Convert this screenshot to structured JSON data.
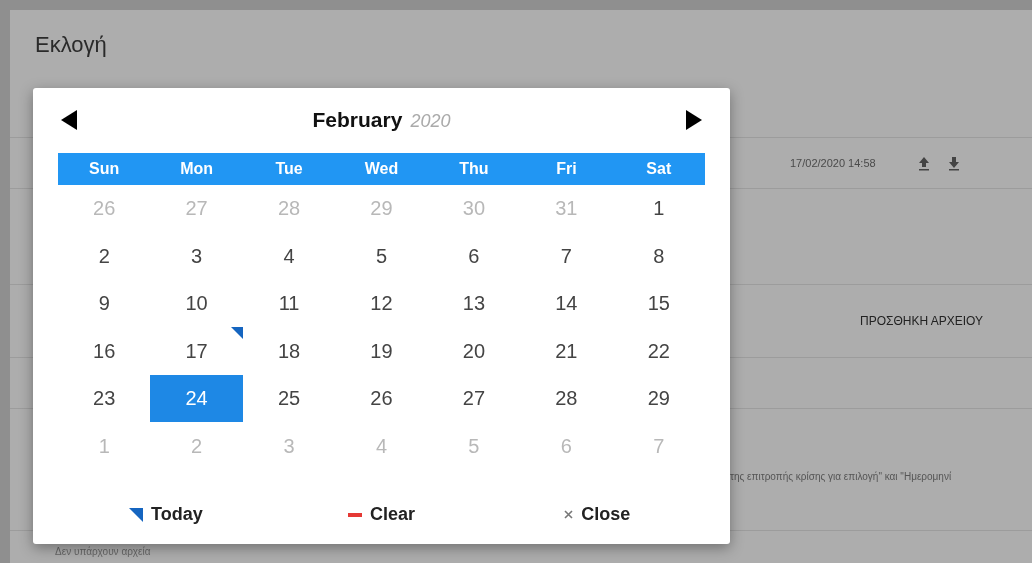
{
  "page": {
    "title": "Εκλογή",
    "file_row": {
      "date": "17/02/2020 14:58"
    },
    "add_file_button": "ΠΡΟΣΘΗΚΗ ΑΡΧΕΙΟΥ",
    "note": "της επιτροπής κρίσης για επιλογή\" και \"Ημερομηνί",
    "empty_message": "Δεν υπάρχουν αρχεία"
  },
  "datepicker": {
    "month": "February",
    "year": "2020",
    "weekdays": [
      "Sun",
      "Mon",
      "Tue",
      "Wed",
      "Thu",
      "Fri",
      "Sat"
    ],
    "days": [
      {
        "label": "26",
        "muted": true,
        "today": false,
        "selected": false
      },
      {
        "label": "27",
        "muted": true,
        "today": false,
        "selected": false
      },
      {
        "label": "28",
        "muted": true,
        "today": false,
        "selected": false
      },
      {
        "label": "29",
        "muted": true,
        "today": false,
        "selected": false
      },
      {
        "label": "30",
        "muted": true,
        "today": false,
        "selected": false
      },
      {
        "label": "31",
        "muted": true,
        "today": false,
        "selected": false
      },
      {
        "label": "1",
        "muted": false,
        "today": false,
        "selected": false
      },
      {
        "label": "2",
        "muted": false,
        "today": false,
        "selected": false
      },
      {
        "label": "3",
        "muted": false,
        "today": false,
        "selected": false
      },
      {
        "label": "4",
        "muted": false,
        "today": false,
        "selected": false
      },
      {
        "label": "5",
        "muted": false,
        "today": false,
        "selected": false
      },
      {
        "label": "6",
        "muted": false,
        "today": false,
        "selected": false
      },
      {
        "label": "7",
        "muted": false,
        "today": false,
        "selected": false
      },
      {
        "label": "8",
        "muted": false,
        "today": false,
        "selected": false
      },
      {
        "label": "9",
        "muted": false,
        "today": false,
        "selected": false
      },
      {
        "label": "10",
        "muted": false,
        "today": false,
        "selected": false
      },
      {
        "label": "11",
        "muted": false,
        "today": false,
        "selected": false
      },
      {
        "label": "12",
        "muted": false,
        "today": false,
        "selected": false
      },
      {
        "label": "13",
        "muted": false,
        "today": false,
        "selected": false
      },
      {
        "label": "14",
        "muted": false,
        "today": false,
        "selected": false
      },
      {
        "label": "15",
        "muted": false,
        "today": false,
        "selected": false
      },
      {
        "label": "16",
        "muted": false,
        "today": false,
        "selected": false
      },
      {
        "label": "17",
        "muted": false,
        "today": true,
        "selected": false
      },
      {
        "label": "18",
        "muted": false,
        "today": false,
        "selected": false
      },
      {
        "label": "19",
        "muted": false,
        "today": false,
        "selected": false
      },
      {
        "label": "20",
        "muted": false,
        "today": false,
        "selected": false
      },
      {
        "label": "21",
        "muted": false,
        "today": false,
        "selected": false
      },
      {
        "label": "22",
        "muted": false,
        "today": false,
        "selected": false
      },
      {
        "label": "23",
        "muted": false,
        "today": false,
        "selected": false
      },
      {
        "label": "24",
        "muted": false,
        "today": false,
        "selected": true
      },
      {
        "label": "25",
        "muted": false,
        "today": false,
        "selected": false
      },
      {
        "label": "26",
        "muted": false,
        "today": false,
        "selected": false
      },
      {
        "label": "27",
        "muted": false,
        "today": false,
        "selected": false
      },
      {
        "label": "28",
        "muted": false,
        "today": false,
        "selected": false
      },
      {
        "label": "29",
        "muted": false,
        "today": false,
        "selected": false
      },
      {
        "label": "1",
        "muted": true,
        "today": false,
        "selected": false
      },
      {
        "label": "2",
        "muted": true,
        "today": false,
        "selected": false
      },
      {
        "label": "3",
        "muted": true,
        "today": false,
        "selected": false
      },
      {
        "label": "4",
        "muted": true,
        "today": false,
        "selected": false
      },
      {
        "label": "5",
        "muted": true,
        "today": false,
        "selected": false
      },
      {
        "label": "6",
        "muted": true,
        "today": false,
        "selected": false
      },
      {
        "label": "7",
        "muted": true,
        "today": false,
        "selected": false
      }
    ],
    "footer": [
      {
        "kind": "today",
        "label": "Today"
      },
      {
        "kind": "clear",
        "label": "Clear"
      },
      {
        "kind": "close",
        "label": "Close"
      }
    ]
  }
}
